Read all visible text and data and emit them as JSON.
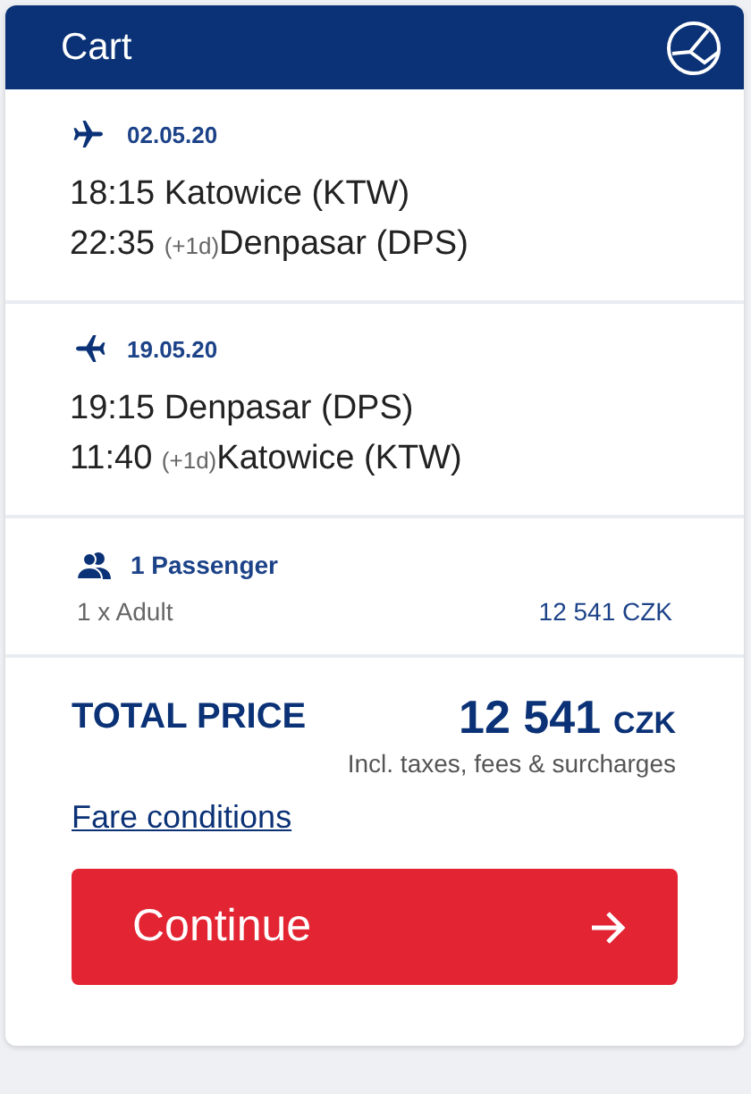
{
  "header": {
    "title": "Cart"
  },
  "flights": [
    {
      "kind": "outbound",
      "date": "02.05.20",
      "departure": {
        "time": "18:15",
        "place": "Katowice (KTW)"
      },
      "arrival": {
        "time": "22:35",
        "day_offset": "(+1d)",
        "place": "Denpasar (DPS)"
      }
    },
    {
      "kind": "return",
      "date": "19.05.20",
      "departure": {
        "time": "19:15",
        "place": "Denpasar (DPS)"
      },
      "arrival": {
        "time": "11:40",
        "day_offset": "(+1d)",
        "place": "Katowice (KTW)"
      }
    }
  ],
  "passengers": {
    "title": "1 Passenger",
    "items": [
      {
        "label": "1 x Adult",
        "price": "12 541 CZK"
      }
    ]
  },
  "total": {
    "label": "TOTAL PRICE",
    "amount": "12 541",
    "currency": "CZK",
    "note": "Incl. taxes, fees & surcharges"
  },
  "fare_link": "Fare conditions",
  "continue_button": "Continue"
}
